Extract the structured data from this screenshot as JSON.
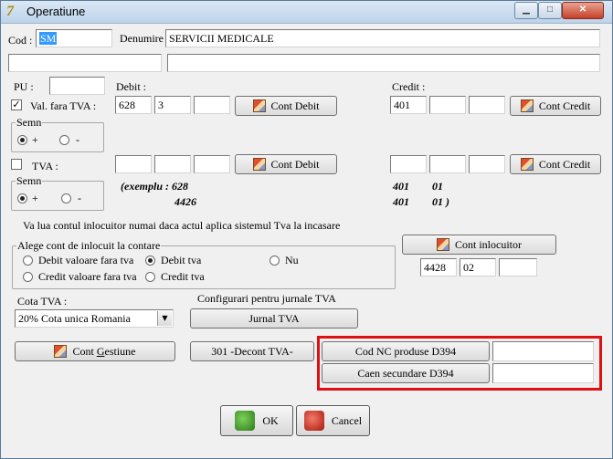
{
  "window": {
    "title": "Operatiune",
    "icon_letter": "7"
  },
  "cod": {
    "label": "Cod :",
    "value": "SM"
  },
  "denumire": {
    "label": "Denumire",
    "value": "SERVICII MEDICALE"
  },
  "pu": {
    "label": "PU :",
    "value": ""
  },
  "debit": {
    "label": "Debit :",
    "v1": "628",
    "v2": "3",
    "v3": "",
    "button": "Cont Debit"
  },
  "credit": {
    "label": "Credit :",
    "v1": "401",
    "v2": "",
    "v3": "",
    "button": "Cont Credit"
  },
  "val_fara_tva": {
    "label": "Val. fara TVA :",
    "checked": true,
    "check_glyph": "✓"
  },
  "semn1": {
    "title": "Semn",
    "plus": "+",
    "minus": "-"
  },
  "tva": {
    "label": "TVA :",
    "checked": false,
    "debit_button": "Cont Debit",
    "credit_button": "Cont Credit"
  },
  "semn2": {
    "title": "Semn",
    "plus": "+",
    "minus": "-"
  },
  "example": {
    "left_line1": "(exemplu :  628",
    "left_line2": "4426",
    "right_line1a": "401",
    "right_line1b": "01",
    "right_line2a": "401",
    "right_line2b": "01 )"
  },
  "info_text": "Va lua contul inlocuitor numai daca actul aplica sistemul Tva la incasare",
  "inlocuit": {
    "title": "Alege cont de inlocuit la contare",
    "opt_debit_val": "Debit valoare fara tva",
    "opt_debit_tva": "Debit tva",
    "opt_nu": "Nu",
    "opt_credit_val": "Credit valoare fara tva",
    "opt_credit_tva": "Credit tva"
  },
  "cont_inlocuitor": {
    "button": "Cont inlocuitor",
    "v1": "4428",
    "v2": "02",
    "v3": ""
  },
  "cota_tva": {
    "label": "Cota TVA :",
    "selected": "20% Cota unica Romania",
    "arrow": "▼"
  },
  "jurnale": {
    "label": "Configurari pentru jurnale TVA",
    "button": "Jurnal TVA"
  },
  "cont_gestiune": {
    "button_before": "Cont ",
    "button_underlined": "G",
    "button_after": "estiune"
  },
  "decont": {
    "button": "301 -Decont TVA-"
  },
  "cod_nc": {
    "button": "Cod NC produse D394",
    "value": ""
  },
  "caen": {
    "button": "Caen secundare D394",
    "value": ""
  },
  "ok": {
    "label": "OK"
  },
  "cancel": {
    "label": "Cancel"
  },
  "titlebar_buttons": {
    "minimize": "▁",
    "maximize": "□",
    "close": "✕"
  },
  "colors": {
    "highlight": "#d11111",
    "selection": "#3399ff"
  }
}
